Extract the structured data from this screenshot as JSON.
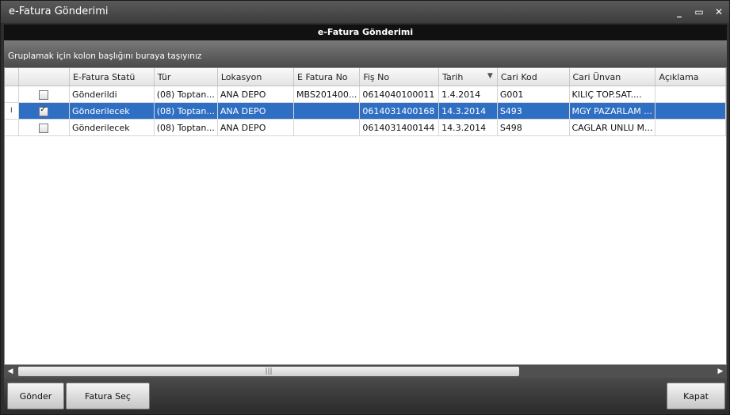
{
  "window": {
    "title": "e-Fatura Gönderimi"
  },
  "panel": {
    "title": "e-Fatura Gönderimi"
  },
  "group_hint": "Gruplamak için kolon başlığını buraya taşıyınız",
  "columns": [
    "E-Fatura Statü",
    "Tür",
    "Lokasyon",
    "E Fatura No",
    "Fiş No",
    "Tarih",
    "Cari Kod",
    "Cari Ünvan",
    "Açıklama"
  ],
  "rows": [
    {
      "checked": false,
      "status": "Gönderildi",
      "tur": "(08) Toptan...",
      "lokasyon": "ANA DEPO",
      "efatura_no": "MBS201400...",
      "fis_no": "0614040100011",
      "tarih": "1.4.2014",
      "cari_kod": "G001",
      "cari_unvan": "KILIÇ TOP.SAT....",
      "aciklama": ""
    },
    {
      "checked": true,
      "selected": true,
      "status": "Gönderilecek",
      "tur": "(08) Toptan...",
      "lokasyon": "ANA DEPO",
      "efatura_no": "",
      "fis_no": "0614031400168",
      "tarih": "14.3.2014",
      "cari_kod": "S493",
      "cari_unvan": "MGY PAZARLAM ...",
      "aciklama": ""
    },
    {
      "checked": false,
      "status": "Gönderilecek",
      "tur": "(08) Toptan...",
      "lokasyon": "ANA DEPO",
      "efatura_no": "",
      "fis_no": "0614031400144",
      "tarih": "14.3.2014",
      "cari_kod": "S498",
      "cari_unvan": "CAGLAR UNLU M...",
      "aciklama": ""
    }
  ],
  "buttons": {
    "gonder": "Gönder",
    "fatura_sec": "Fatura Seç",
    "kapat": "Kapat"
  },
  "colors": {
    "selection": "#2f6fc3",
    "header_bg": "#111111"
  },
  "icons": {
    "minimize": "minimize-icon",
    "maximize": "maximize-icon",
    "close": "close-icon",
    "sort": "sort-desc-icon"
  }
}
